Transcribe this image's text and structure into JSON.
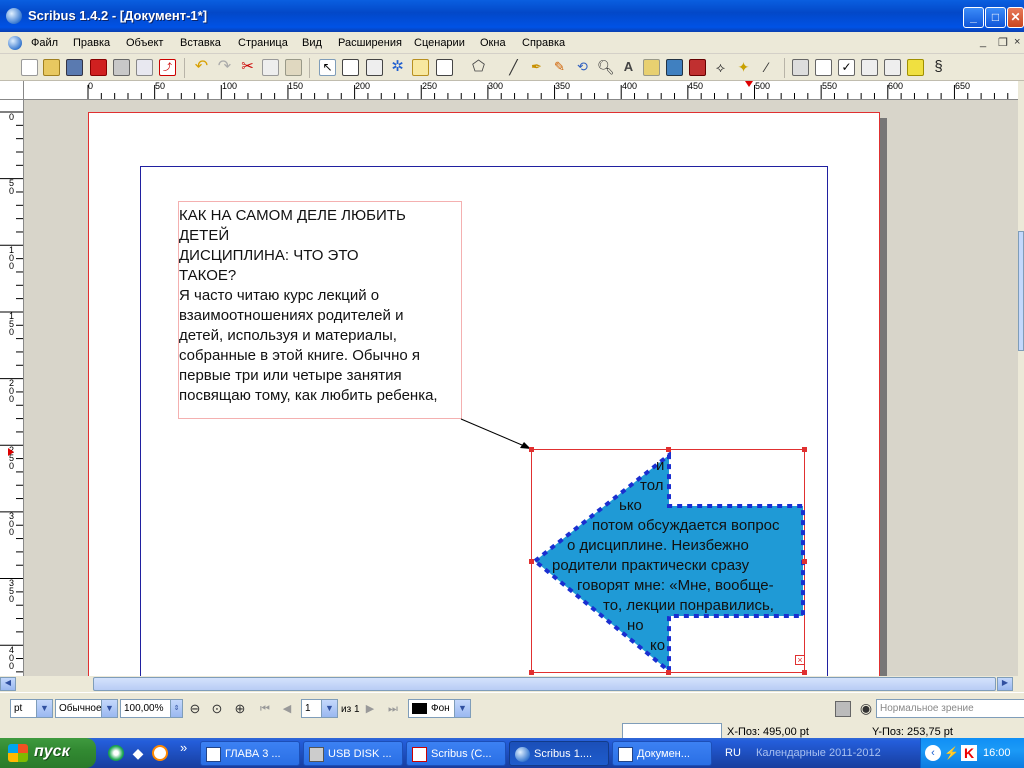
{
  "window": {
    "title": "Scribus 1.4.2 - [Документ-1*]"
  },
  "menu": [
    "Файл",
    "Правка",
    "Объект",
    "Вставка",
    "Страница",
    "Вид",
    "Расширения",
    "Сценарии",
    "Окна",
    "Справка"
  ],
  "ruler": {
    "h_labels": [
      "0",
      "50",
      "100",
      "150",
      "200",
      "250",
      "300",
      "350",
      "400",
      "450",
      "500",
      "550",
      "600",
      "650"
    ],
    "v_labels": [
      "0",
      "50",
      "100",
      "150",
      "200",
      "250",
      "300",
      "350",
      "400"
    ]
  },
  "document": {
    "text_frame_lines": [
      "  КАК НА САМОМ ДЕЛЕ ЛЮБИТЬ",
      "ДЕТЕЙ",
      "        ДИСЦИПЛИНА: ЧТО ЭТО",
      "ТАКОЕ?",
      "   Я часто читаю курс лекций о",
      "взаимоотношениях родителей и",
      "детей, используя и материалы,",
      "собранные в этой книге. Обычно я",
      "первые три или четыре занятия",
      "посвящаю тому, как любить ребенка,"
    ],
    "arrow_text_lines": [
      "и",
      "тол",
      "ько",
      "потом обсуждается вопрос",
      "о дисциплине. Неизбежно",
      "родители практически сразу",
      "говорят мне: «Мне, вообще-",
      "то, лекции понравились,",
      "но",
      "ко"
    ],
    "arrow_fill": "#1f9ad6",
    "arrow_outline": "#1a2fd0"
  },
  "statusbar": {
    "unit": "pt",
    "style": "Обычное",
    "zoom": "100,00%",
    "page_current": "1",
    "page_of": "из 1",
    "layer": "Фон",
    "view_mode": "Нормальное зрение"
  },
  "coords": {
    "x": "X-Поз: 495,00 pt",
    "y": "Y-Поз: 253,75 pt"
  },
  "taskbar": {
    "start": "пуск",
    "chevron": "»",
    "tasks": [
      "ГЛАВА 3 ...",
      "USB DISK ...",
      "Scribus (C...",
      "Scribus 1....",
      "Докумен..."
    ],
    "lang": "RU",
    "tray_app": "Календарные 2011-2012",
    "time": "16:00"
  }
}
